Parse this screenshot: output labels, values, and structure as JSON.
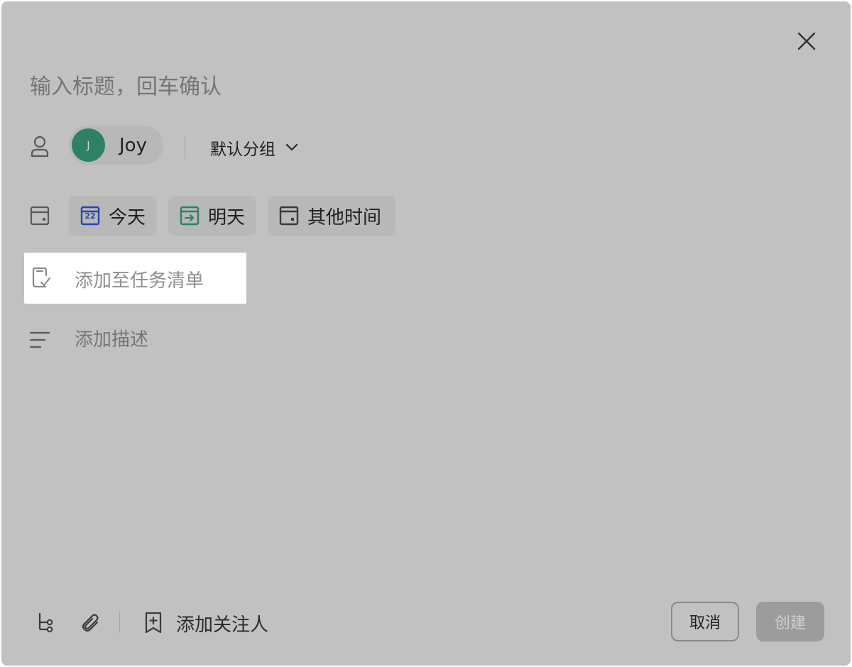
{
  "dialog": {
    "title_placeholder": "输入标题，回车确认",
    "close_icon": "close-icon"
  },
  "assignee": {
    "avatar_initial": "J",
    "name": "Joy",
    "avatar_color": "#2e8166"
  },
  "group": {
    "label": "默认分组",
    "chevron_icon": "chevron-down-icon"
  },
  "due_date": {
    "options": [
      {
        "label": "今天",
        "icon": "calendar-today-icon",
        "icon_text": "22",
        "color": "#2b43b5"
      },
      {
        "label": "明天",
        "icon": "calendar-arrow-icon",
        "color": "#2e8166"
      },
      {
        "label": "其他时间",
        "icon": "calendar-icon",
        "color": "#3a3a3a"
      }
    ]
  },
  "task_list": {
    "label": "添加至任务清单"
  },
  "description": {
    "label": "添加描述"
  },
  "footer": {
    "add_follower_label": "添加关注人",
    "cancel_label": "取消",
    "create_label": "创建"
  }
}
